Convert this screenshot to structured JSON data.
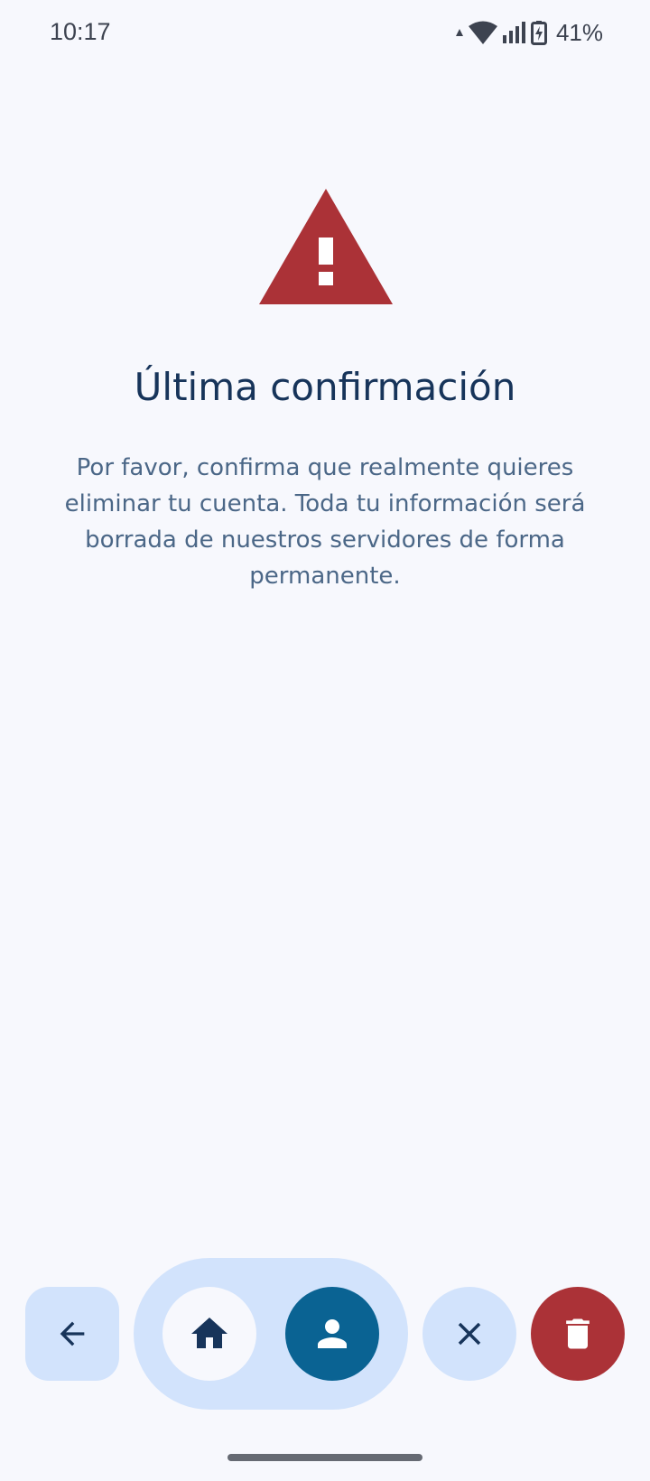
{
  "status_bar": {
    "time": "10:17",
    "battery": "41%",
    "icons": [
      "data-arrow-icon",
      "wifi-icon",
      "signal-icon",
      "battery-charging-icon"
    ]
  },
  "warning": {
    "icon": "warning-triangle-icon",
    "color": "#ab3237"
  },
  "title": "Última confirmación",
  "message": "Por favor, confirma que realmente quieres eliminar tu cuenta. Toda tu información será borrada de nuestros servidores de forma permanente.",
  "bottom_nav": {
    "back_icon": "arrow-back-icon",
    "home_icon": "home-icon",
    "profile_icon": "person-icon",
    "close_icon": "close-icon",
    "delete_icon": "trash-icon",
    "accent_color": "#0a6393",
    "pill_color": "#d2e3fc",
    "danger_color": "#ab3237"
  }
}
